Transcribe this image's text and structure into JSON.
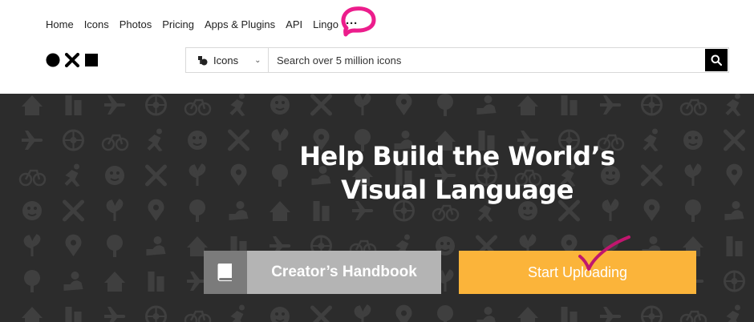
{
  "nav": {
    "items": [
      "Home",
      "Icons",
      "Photos",
      "Pricing",
      "Apps & Plugins",
      "API",
      "Lingo"
    ],
    "more_label": "···",
    "annotation_color": "#ec1d8c"
  },
  "search": {
    "type_label": "Icons",
    "placeholder": "Search over 5 million icons"
  },
  "hero": {
    "title_line1": "Help Build the World’s",
    "title_line2": "Visual Language",
    "handbook_label": "Creator’s Handbook",
    "upload_label": "Start Uploading",
    "background_color": "#2c2c2c",
    "upload_color": "#fbb43a",
    "handbook_color": "#b4b4b4"
  },
  "icons": {
    "logo": "circle-x-square-logo",
    "search": "magnifier-icon",
    "type": "icons-category-icon",
    "chevron": "chevron-down-icon",
    "handbook": "book-icon"
  }
}
